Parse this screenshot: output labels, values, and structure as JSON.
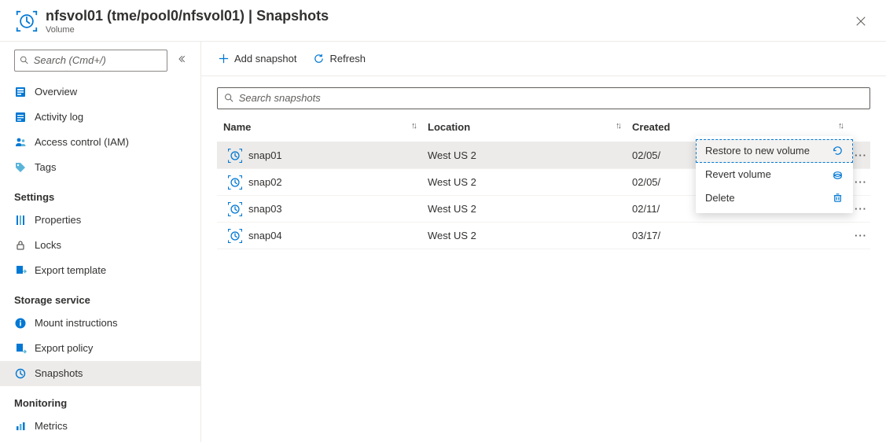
{
  "header": {
    "title": "nfsvol01 (tme/pool0/nfsvol01) | Snapshots",
    "subtitle": "Volume"
  },
  "sidebar": {
    "search_placeholder": "Search (Cmd+/)",
    "top_items": [
      {
        "label": "Overview",
        "icon": "overview"
      },
      {
        "label": "Activity log",
        "icon": "activity-log"
      },
      {
        "label": "Access control (IAM)",
        "icon": "access-control"
      },
      {
        "label": "Tags",
        "icon": "tags"
      }
    ],
    "sections": [
      {
        "title": "Settings",
        "items": [
          {
            "label": "Properties",
            "icon": "properties"
          },
          {
            "label": "Locks",
            "icon": "locks"
          },
          {
            "label": "Export template",
            "icon": "export-template"
          }
        ]
      },
      {
        "title": "Storage service",
        "items": [
          {
            "label": "Mount instructions",
            "icon": "mount-instructions"
          },
          {
            "label": "Export policy",
            "icon": "export-policy"
          },
          {
            "label": "Snapshots",
            "icon": "snapshots",
            "active": true
          }
        ]
      },
      {
        "title": "Monitoring",
        "items": [
          {
            "label": "Metrics",
            "icon": "metrics"
          }
        ]
      }
    ]
  },
  "toolbar": {
    "add_label": "Add snapshot",
    "refresh_label": "Refresh"
  },
  "grid": {
    "search_placeholder": "Search snapshots",
    "columns": {
      "name": "Name",
      "location": "Location",
      "created": "Created"
    },
    "rows": [
      {
        "name": "snap01",
        "location": "West US 2",
        "created": "02/05/",
        "selected": true
      },
      {
        "name": "snap02",
        "location": "West US 2",
        "created": "02/05/"
      },
      {
        "name": "snap03",
        "location": "West US 2",
        "created": "02/11/"
      },
      {
        "name": "snap04",
        "location": "West US 2",
        "created": "03/17/"
      }
    ]
  },
  "context_menu": {
    "items": [
      {
        "label": "Restore to new volume",
        "icon": "restore",
        "selected": true
      },
      {
        "label": "Revert volume",
        "icon": "revert"
      },
      {
        "label": "Delete",
        "icon": "delete"
      }
    ]
  }
}
